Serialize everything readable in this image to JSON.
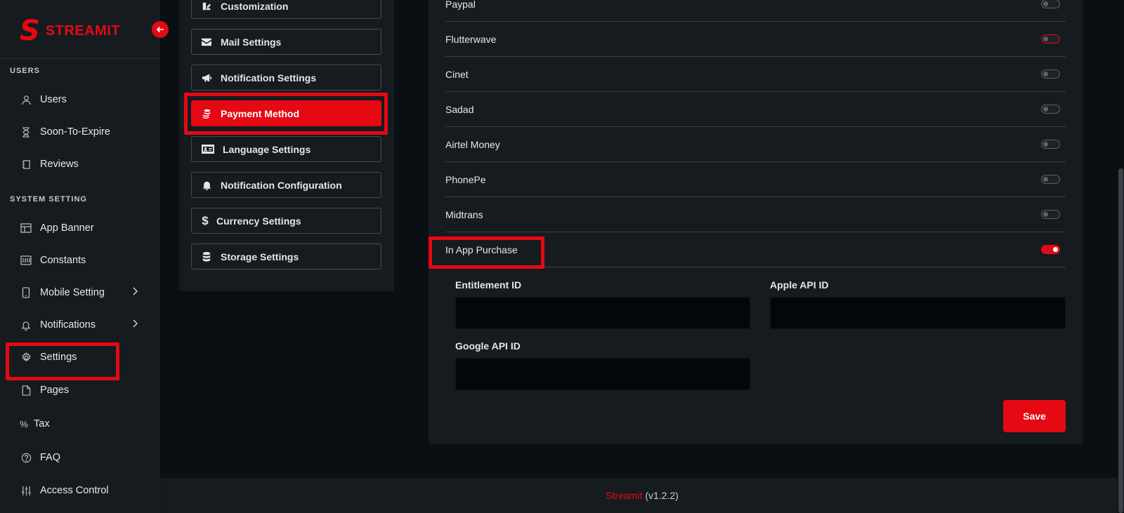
{
  "brand": {
    "name": "STREAMIT"
  },
  "sidebar": {
    "sections": [
      {
        "title": "USERS"
      },
      {
        "title": "SYSTEM SETTING"
      }
    ],
    "items": [
      {
        "label": "Users",
        "icon": "user-icon"
      },
      {
        "label": "Soon-To-Expire",
        "icon": "hourglass-icon"
      },
      {
        "label": "Reviews",
        "icon": "review-icon"
      },
      {
        "label": "App Banner",
        "icon": "banner-icon"
      },
      {
        "label": "Constants",
        "icon": "constants-icon"
      },
      {
        "label": "Mobile Setting",
        "icon": "mobile-icon"
      },
      {
        "label": "Notifications",
        "icon": "bell-icon"
      },
      {
        "label": "Settings",
        "icon": "gear-icon"
      },
      {
        "label": "Pages",
        "icon": "page-icon"
      },
      {
        "label": "Tax",
        "icon": "percent-icon"
      },
      {
        "label": "FAQ",
        "icon": "question-icon"
      },
      {
        "label": "Access Control",
        "icon": "sliders-icon"
      }
    ]
  },
  "settings_menu": {
    "items": [
      {
        "label": "Customization",
        "icon": "brush-icon"
      },
      {
        "label": "Mail Settings",
        "icon": "mail-icon"
      },
      {
        "label": "Notification Settings",
        "icon": "megaphone-icon"
      },
      {
        "label": "Payment Method",
        "icon": "coins-icon",
        "active": true
      },
      {
        "label": "Language Settings",
        "icon": "id-card-icon"
      },
      {
        "label": "Notification Configuration",
        "icon": "bell-icon"
      },
      {
        "label": "Currency Settings",
        "icon": "dollar-icon"
      },
      {
        "label": "Storage Settings",
        "icon": "database-icon"
      }
    ]
  },
  "payment_methods": [
    {
      "label": "Paypal",
      "enabled": false
    },
    {
      "label": "Flutterwave",
      "enabled": false
    },
    {
      "label": "Cinet",
      "enabled": false
    },
    {
      "label": "Sadad",
      "enabled": false
    },
    {
      "label": "Airtel Money",
      "enabled": false
    },
    {
      "label": "PhonePe",
      "enabled": false
    },
    {
      "label": "Midtrans",
      "enabled": false
    },
    {
      "label": "In App Purchase",
      "enabled": true
    }
  ],
  "in_app_purchase": {
    "entitlement_label": "Entitlement ID",
    "entitlement_value": "",
    "apple_label": "Apple API ID",
    "apple_value": "",
    "google_label": "Google API ID",
    "google_value": ""
  },
  "save_label": "Save",
  "footer": {
    "brand": "Streamit",
    "version": "(v1.2.2)"
  },
  "colors": {
    "accent": "#e50914",
    "background": "#0a0f14",
    "panel": "#161b20"
  }
}
